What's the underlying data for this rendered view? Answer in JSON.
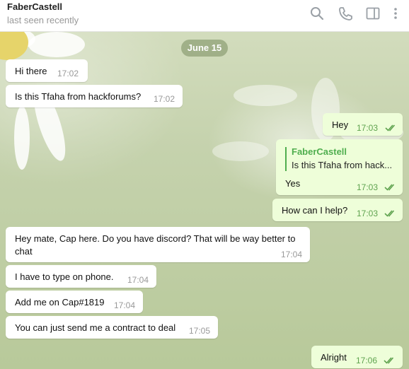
{
  "header": {
    "title": "FaberCastell",
    "subtitle": "last seen recently",
    "icons": [
      "search-icon",
      "phone-icon",
      "sidebar-icon",
      "more-icon"
    ]
  },
  "date_label": "June 15",
  "messages": [
    {
      "dir": "in",
      "text": "Hi there",
      "time": "17:02"
    },
    {
      "dir": "in",
      "text": "Is this Tfaha from hackforums?",
      "time": "17:02"
    },
    {
      "dir": "out",
      "text": "Hey",
      "time": "17:03",
      "read": true
    },
    {
      "dir": "out",
      "reply_to": {
        "name": "FaberCastell",
        "text": "Is this Tfaha from hack..."
      },
      "text": "Yes",
      "time": "17:03",
      "read": true
    },
    {
      "dir": "out",
      "text": "How can I help?",
      "time": "17:03",
      "read": true
    },
    {
      "dir": "in",
      "text": "Hey mate, Cap here. Do you have discord? That will be way better to chat",
      "time": "17:04"
    },
    {
      "dir": "in",
      "text": "I have to type on phone.",
      "time": "17:04"
    },
    {
      "dir": "in",
      "text": "Add me on Cap#1819",
      "time": "17:04"
    },
    {
      "dir": "in",
      "text": "You can just send me a contract to deal",
      "time": "17:05"
    },
    {
      "dir": "out",
      "text": "Alright",
      "time": "17:06",
      "read": true
    }
  ],
  "colors": {
    "outgoing_bubble": "#eefed9",
    "incoming_bubble": "#ffffff",
    "accent_green": "#4fae4e"
  }
}
